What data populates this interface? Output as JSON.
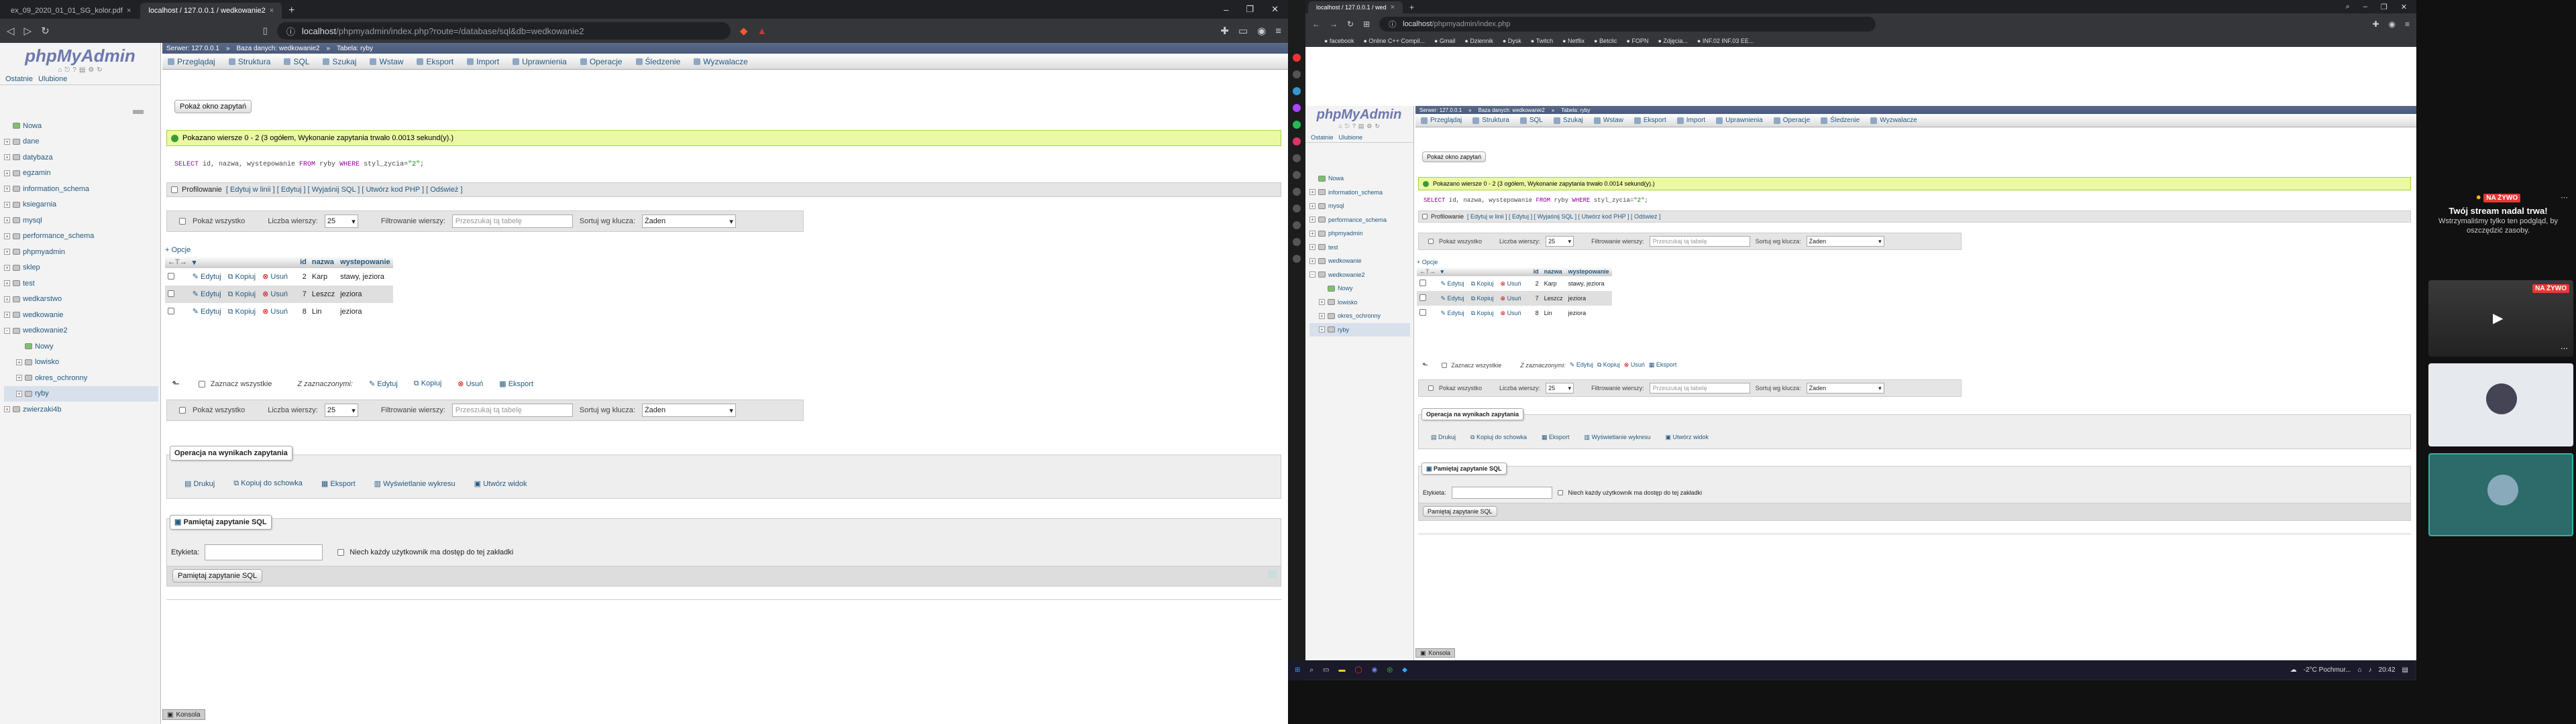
{
  "left": {
    "tabs": [
      {
        "label": "ex_09_2020_01_01_SG_kolor.pdf",
        "active": false
      },
      {
        "label": "localhost / 127.0.0.1 / wedkowanie2",
        "active": true
      }
    ],
    "url_host": "localhost",
    "url_path": "/phpmyadmin/index.php?route=/database/sql&db=wedkowanie2",
    "pma": {
      "logo": "phpMyAdmin",
      "side_tabs": [
        "Ostatnie",
        "Ulubione"
      ],
      "tree": [
        "Nowa",
        "dane",
        "datybaza",
        "egzamin",
        "information_schema",
        "ksiegarnia",
        "mysql",
        "performance_schema",
        "phpmyadmin",
        "sklep",
        "test",
        "wedkarstwo",
        "wedkowanie",
        "wedkowanie2",
        "Nowy",
        "lowisko",
        "okres_ochronny",
        "ryby",
        "zwierzaki4b"
      ],
      "breadcrumb": [
        "Serwer: 127.0.0.1",
        "Baza danych: wedkowanie2",
        "Tabela: ryby"
      ],
      "menu": [
        "Przeglądaj",
        "Struktura",
        "SQL",
        "Szukaj",
        "Wstaw",
        "Eksport",
        "Import",
        "Uprawnienia",
        "Operacje",
        "Śledzenie",
        "Wyzwalacze"
      ],
      "show_query_window": "Pokaż okno zapytań",
      "success": "Pokazano wiersze 0 - 2 (3 ogółem, Wykonanie zapytania trwało 0.0013 sekund(y).)",
      "sql": {
        "kw1": "SELECT",
        "cols": " id, nazwa, wystepowanie ",
        "kw2": "FROM",
        "tbl": " ryby ",
        "kw3": "WHERE",
        "cond": " styl_zycia=",
        "val": "\"2\"",
        "end": ";"
      },
      "profiling": "Profilowanie",
      "prof_links": "[ Edytuj w linii ] [ Edytuj ] [ Wyjaśnij SQL ] [ Utwórz kod PHP ] [ Odśwież ]",
      "nav": {
        "show_all": "Pokaż wszystko",
        "rows_label": "Liczba wierszy:",
        "rows": "25",
        "filter_label": "Filtrowanie wierszy:",
        "filter_placeholder": "Przeszukaj tą tabelę",
        "sort_label": "Sortuj wg klucza:",
        "sort_value": "Żaden"
      },
      "options": "+ Opcje",
      "columns": [
        "id",
        "nazwa",
        "wystepowanie"
      ],
      "rows": [
        {
          "id": "2",
          "nazwa": "Karp",
          "wystepowanie": "stawy, jeziora"
        },
        {
          "id": "7",
          "nazwa": "Leszcz",
          "wystepowanie": "jeziora"
        },
        {
          "id": "8",
          "nazwa": "Lin",
          "wystepowanie": "jeziora"
        }
      ],
      "row_actions": [
        "Edytuj",
        "Kopiuj",
        "Usuń"
      ],
      "check_all": "Zaznacz wszystkie",
      "with_selected": "Z zaznaczonymi:",
      "bulk": [
        "Edytuj",
        "Kopiuj",
        "Usuń",
        "Eksport"
      ],
      "ops_legend": "Operacja na wynikach zapytania",
      "ops": [
        "Drukuj",
        "Kopiuj do schowka",
        "Eksport",
        "Wyświetlanie wykresu",
        "Utwórz widok"
      ],
      "bookmark_legend": "Pamiętaj zapytanie SQL",
      "label_field": "Etykieta:",
      "share_label": "Niech każdy użytkownik ma dostęp do tej zakładki",
      "bookmark_btn": "Pamiętaj zapytanie SQL",
      "console": "Konsola"
    }
  },
  "right": {
    "tabs": [
      {
        "label": "localhost / 127.0.0.1 / wed",
        "active": true
      }
    ],
    "url_host": "localhost",
    "url_path": "/phpmyadmin/index.php",
    "bookmarks": [
      "facebook",
      "Online C++ Compil...",
      "Gmail",
      "Dziennik",
      "Dysk",
      "Twitch",
      "Netflix",
      "Betclic",
      "FOPN",
      "Zdjęcia...",
      "INF.02 INF.03 EE..."
    ],
    "pma": {
      "logo": "phpMyAdmin",
      "side_tabs": [
        "Ostatnie",
        "Ulubione"
      ],
      "tree": [
        "Nowa",
        "information_schema",
        "mysql",
        "performance_schema",
        "phpmyadmin",
        "test",
        "wedkowanie",
        "wedkowanie2",
        "Nowy",
        "lowisko",
        "okres_ochronny",
        "ryby"
      ],
      "breadcrumb": [
        "Serwer: 127.0.0.1",
        "Baza danych: wedkowanie2",
        "Tabela: ryby"
      ],
      "menu": [
        "Przeglądaj",
        "Struktura",
        "SQL",
        "Szukaj",
        "Wstaw",
        "Eksport",
        "Import",
        "Uprawnienia",
        "Operacje",
        "Śledzenie",
        "Wyzwalacze"
      ],
      "show_query_window": "Pokaż okno zapytań",
      "success": "Pokazano wiersze 0 - 2 (3 ogółem, Wykonanie zapytania trwało 0.0014 sekund(y).)",
      "sql": {
        "kw1": "SELECT",
        "cols": " id, nazwa, wystepowanie ",
        "kw2": "FROM",
        "tbl": " ryby ",
        "kw3": "WHERE",
        "cond": " styl_zycia=",
        "val": "\"2\"",
        "end": ";"
      },
      "profiling": "Profilowanie",
      "prof_links": "[ Edytuj w linii ] [ Edytuj ] [ Wyjaśnij SQL ] [ Utwórz kod PHP ] [ Odśwież ]",
      "nav": {
        "show_all": "Pokaż wszystko",
        "rows_label": "Liczba wierszy:",
        "rows": "25",
        "filter_label": "Filtrowanie wierszy:",
        "filter_placeholder": "Przeszukaj tą tabelę",
        "sort_label": "Sortuj wg klucza:",
        "sort_value": "Żaden"
      },
      "options": "+ Opcje",
      "columns": [
        "id",
        "nazwa",
        "wystepowanie"
      ],
      "rows": [
        {
          "id": "2",
          "nazwa": "Karp",
          "wystepowanie": "stawy, jeziora"
        },
        {
          "id": "7",
          "nazwa": "Leszcz",
          "wystepowanie": "jeziora"
        },
        {
          "id": "8",
          "nazwa": "Lin",
          "wystepowanie": "jeziora"
        }
      ],
      "row_actions": [
        "Edytuj",
        "Kopiuj",
        "Usuń"
      ],
      "check_all": "Zaznacz wszystkie",
      "with_selected": "Z zaznaczonymi:",
      "bulk": [
        "Edytuj",
        "Kopiuj",
        "Usuń",
        "Eksport"
      ],
      "ops_legend": "Operacja na wynikach zapytania",
      "ops": [
        "Drukuj",
        "Kopiuj do schowka",
        "Eksport",
        "Wyświetlanie wykresu",
        "Utwórz widok"
      ],
      "bookmark_legend": "Pamiętaj zapytanie SQL",
      "label_field": "Etykieta:",
      "share_label": "Niech każdy użytkownik ma dostęp do tej zakładki",
      "bookmark_btn": "Pamiętaj zapytanie SQL",
      "console": "Konsola"
    },
    "taskbar": {
      "weather": "-2°C Pochmur...",
      "time": "20:42"
    },
    "stream": {
      "live": "NA ŻYWO",
      "title": "Twój stream nadal trwa!",
      "desc": "Wstrzymaliśmy tylko ten podgląd, by oszczędzić zasoby."
    }
  }
}
